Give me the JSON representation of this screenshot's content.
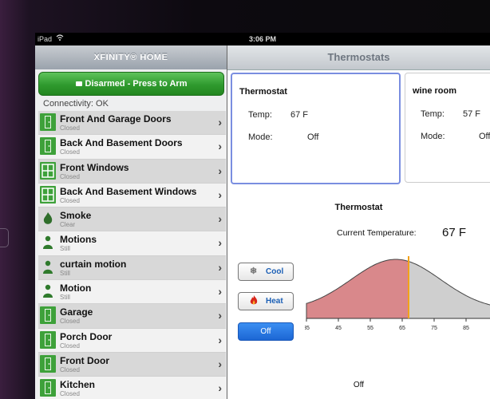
{
  "status_bar": {
    "carrier": "iPad",
    "time": "3:06 PM"
  },
  "sidebar": {
    "header": "XFINITY® HOME",
    "arm_button": "Disarmed - Press to Arm",
    "connectivity": "Connectivity: OK",
    "items": [
      {
        "name": "Front And Garage Doors",
        "state": "Closed",
        "icon": "door-icon"
      },
      {
        "name": "Back And Basement Doors",
        "state": "Closed",
        "icon": "door-icon"
      },
      {
        "name": "Front Windows",
        "state": "Closed",
        "icon": "window-icon"
      },
      {
        "name": "Back And Basement Windows",
        "state": "Closed",
        "icon": "window-icon"
      },
      {
        "name": "Smoke",
        "state": "Clear",
        "icon": "smoke-icon"
      },
      {
        "name": "Motions",
        "state": "Still",
        "icon": "motion-person-icon"
      },
      {
        "name": "curtain motion",
        "state": "Still",
        "icon": "motion-person-icon"
      },
      {
        "name": "Motion",
        "state": "Still",
        "icon": "motion-person-icon"
      },
      {
        "name": "Garage",
        "state": "Closed",
        "icon": "door-icon"
      },
      {
        "name": "Porch Door",
        "state": "Closed",
        "icon": "door-icon"
      },
      {
        "name": "Front Door",
        "state": "Closed",
        "icon": "door-icon"
      },
      {
        "name": "Kitchen",
        "state": "Closed",
        "icon": "door-icon"
      }
    ]
  },
  "main": {
    "header": "Thermostats",
    "cards": [
      {
        "title": "Thermostat",
        "temp_label": "Temp:",
        "temp": "67 F",
        "mode_label": "Mode:",
        "mode": "Off"
      },
      {
        "title": "wine room",
        "temp_label": "Temp:",
        "temp": "57 F",
        "mode_label": "Mode:",
        "mode": "Off"
      }
    ],
    "detail": {
      "title": "Thermostat",
      "current_label": "Current Temperature:",
      "current_value": "67 F",
      "buttons": {
        "cool": "Cool",
        "heat": "Heat",
        "off": "Off"
      },
      "mode_text": "Off",
      "axis_ticks": [
        "35",
        "45",
        "55",
        "65",
        "75",
        "85"
      ]
    }
  },
  "colors": {
    "accent_green": "#2f9a2e",
    "selected_border": "#7a8ee0",
    "heat_fill": "#d9888b",
    "cool_fill": "#cfcfcf",
    "marker": "#f3a21a",
    "off_button": "#2a7be4"
  }
}
